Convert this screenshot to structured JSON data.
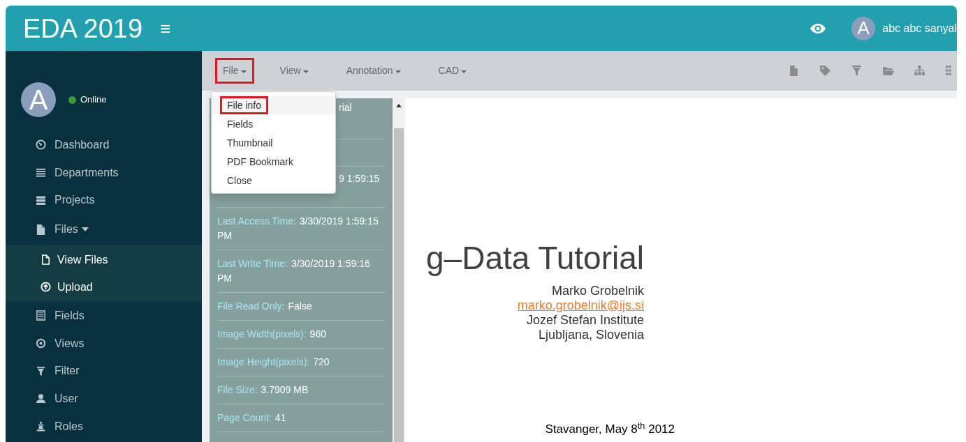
{
  "header": {
    "title": "EDA 2019",
    "menu_glyph": "≡",
    "user": {
      "avatar_letter": "A",
      "name": "abc abc sanyal"
    }
  },
  "sidebar": {
    "profile": {
      "avatar_letter": "A",
      "status": "Online",
      "online": true
    },
    "items": [
      {
        "label": "Dashboard"
      },
      {
        "label": "Departments"
      },
      {
        "label": "Projects"
      },
      {
        "label": "Files",
        "expanded": true,
        "children": [
          {
            "label": "View Files"
          },
          {
            "label": "Upload"
          }
        ]
      },
      {
        "label": "Fields"
      },
      {
        "label": "Views"
      },
      {
        "label": "Filter"
      },
      {
        "label": "User"
      },
      {
        "label": "Roles"
      }
    ]
  },
  "toolbar": {
    "menus": [
      {
        "label": "File",
        "highlighted": true
      },
      {
        "label": "View",
        "highlighted": false
      },
      {
        "label": "Annotation",
        "highlighted": false
      },
      {
        "label": "CAD",
        "highlighted": false
      }
    ]
  },
  "file_menu": {
    "open": true,
    "items": [
      {
        "label": "File info",
        "highlighted": true
      },
      {
        "label": "Fields",
        "highlighted": false
      },
      {
        "label": "Thumbnail",
        "highlighted": false
      },
      {
        "label": "PDF Bookmark",
        "highlighted": false
      },
      {
        "label": "Close",
        "highlighted": false
      }
    ]
  },
  "info_panel": {
    "covered_fragments": [
      "rial",
      "9 1:59:15"
    ],
    "items": [
      {
        "label": "Last Access Time:",
        "value": "3/30/2019 1:59:15 PM"
      },
      {
        "label": "Last Write Time:",
        "value": "3/30/2019 1:59:16 PM"
      },
      {
        "label": "File Read Only:",
        "value": "False"
      },
      {
        "label": "Image Width(pixels):",
        "value": "960"
      },
      {
        "label": "Image Height(pixels):",
        "value": "720"
      },
      {
        "label": "File Size:",
        "value": "3.7909 MB"
      },
      {
        "label": "Page Count:",
        "value": "41"
      }
    ]
  },
  "document": {
    "title": "g–Data Tutorial",
    "author": "Marko Grobelnik",
    "email": "marko.grobelnik@ijs.si",
    "affiliation": "Jozef Stefan Institute",
    "location": "Ljubljana, Slovenia",
    "date": "Stavanger, May 8$^{th}$ 2012"
  }
}
